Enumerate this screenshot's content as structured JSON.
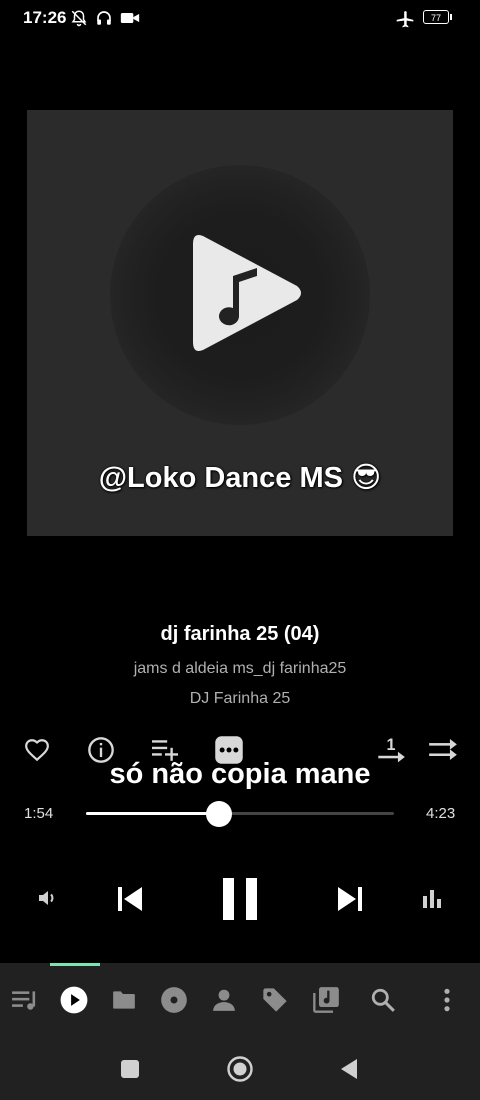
{
  "status_bar": {
    "time": "17:26",
    "battery": "77",
    "icons": [
      "bell-off-icon",
      "headphones-icon",
      "video-camera-icon",
      "airplane-icon",
      "battery-icon"
    ]
  },
  "album_art": {
    "overlay_text": "@Loko Dance MS 😎"
  },
  "track": {
    "title": "dj farinha 25 (04)",
    "album": "jams d aldeia ms_dj farinha25",
    "artist": "DJ Farinha 25"
  },
  "actions": {
    "items": [
      "heart-icon",
      "info-icon",
      "add-to-playlist-icon",
      "more-icon",
      "repeat-one-icon",
      "shuffle-icon"
    ],
    "repeat_badge": "1",
    "overlay_caption": "só não copia mane"
  },
  "progress": {
    "current": "1:54",
    "total": "4:23",
    "fraction": 0.433
  },
  "transport": [
    "volume-icon",
    "previous-icon",
    "pause-icon",
    "next-icon",
    "equalizer-icon"
  ],
  "bottom_nav": {
    "items": [
      "queue-icon",
      "now-playing-icon",
      "folder-icon",
      "album-icon",
      "artist-icon",
      "tag-icon",
      "playlist-icon",
      "search-icon",
      "menu-icon"
    ],
    "active": "now-playing-icon",
    "accent_color": "#7de3b4"
  },
  "system_nav": [
    "recents-button",
    "home-button",
    "back-button"
  ]
}
